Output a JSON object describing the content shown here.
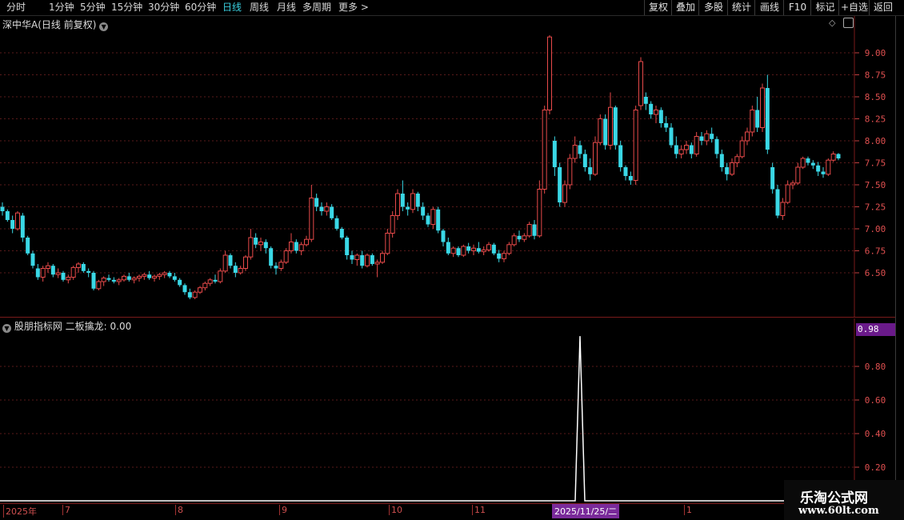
{
  "toolbar": {
    "periods": [
      "分时",
      "1分钟",
      "5分钟",
      "15分钟",
      "30分钟",
      "60分钟",
      "日线",
      "周线",
      "月线",
      "多周期",
      "更多"
    ],
    "active_period": "日线",
    "more_arrow": ">",
    "right_buttons": [
      "复权",
      "叠加",
      "多股",
      "统计",
      "画线",
      "F10",
      "标记",
      "+自选",
      "返回"
    ]
  },
  "main_pane": {
    "title": "深中华A(日线 前复权)",
    "price_ticks": [
      "9.00",
      "8.75",
      "8.50",
      "8.25",
      "8.00",
      "7.75",
      "7.50",
      "7.25",
      "7.00",
      "6.75",
      "6.50"
    ]
  },
  "sub_pane": {
    "title": "股朋指标网 二板擒龙: 0.00",
    "current_value": "0.98",
    "ticks": [
      "0.80",
      "0.60",
      "0.40",
      "0.20"
    ]
  },
  "date_axis": {
    "labels": [
      "2025年",
      "7",
      "8",
      "9",
      "10",
      "11",
      "1"
    ],
    "cursor_date": "2025/11/25/二"
  },
  "watermark": {
    "line1": "乐淘公式网",
    "line2": "www.60lt.com"
  },
  "colors": {
    "up": "#e84a4a",
    "down": "#3ad8e6",
    "grid": "#5a1a1a",
    "accent": "#3ad0e0",
    "cursor_bg": "#7a2a9a"
  },
  "candles": [
    [
      7.25,
      7.3,
      7.15,
      7.2
    ],
    [
      7.2,
      7.22,
      7.08,
      7.1
    ],
    [
      7.1,
      7.15,
      6.95,
      7.0
    ],
    [
      7.0,
      7.2,
      6.98,
      7.18
    ],
    [
      7.15,
      7.18,
      6.85,
      6.9
    ],
    [
      6.9,
      6.92,
      6.7,
      6.72
    ],
    [
      6.72,
      6.75,
      6.55,
      6.58
    ],
    [
      6.55,
      6.6,
      6.42,
      6.45
    ],
    [
      6.45,
      6.58,
      6.4,
      6.55
    ],
    [
      6.55,
      6.62,
      6.5,
      6.58
    ],
    [
      6.58,
      6.6,
      6.45,
      6.48
    ],
    [
      6.48,
      6.55,
      6.44,
      6.5
    ],
    [
      6.5,
      6.52,
      6.4,
      6.42
    ],
    [
      6.42,
      6.48,
      6.38,
      6.45
    ],
    [
      6.45,
      6.58,
      6.42,
      6.56
    ],
    [
      6.56,
      6.62,
      6.5,
      6.6
    ],
    [
      6.6,
      6.62,
      6.5,
      6.52
    ],
    [
      6.52,
      6.55,
      6.45,
      6.5
    ],
    [
      6.5,
      6.52,
      6.3,
      6.32
    ],
    [
      6.32,
      6.42,
      6.3,
      6.4
    ],
    [
      6.4,
      6.46,
      6.35,
      6.44
    ],
    [
      6.44,
      6.48,
      6.4,
      6.42
    ],
    [
      6.42,
      6.45,
      6.38,
      6.4
    ],
    [
      6.4,
      6.44,
      6.36,
      6.42
    ],
    [
      6.42,
      6.48,
      6.4,
      6.46
    ],
    [
      6.46,
      6.5,
      6.4,
      6.42
    ],
    [
      6.42,
      6.46,
      6.38,
      6.44
    ],
    [
      6.44,
      6.48,
      6.4,
      6.46
    ],
    [
      6.46,
      6.5,
      6.42,
      6.48
    ],
    [
      6.48,
      6.52,
      6.42,
      6.44
    ],
    [
      6.44,
      6.48,
      6.4,
      6.46
    ],
    [
      6.46,
      6.5,
      6.42,
      6.48
    ],
    [
      6.48,
      6.52,
      6.44,
      6.5
    ],
    [
      6.5,
      6.52,
      6.44,
      6.46
    ],
    [
      6.46,
      6.5,
      6.4,
      6.42
    ],
    [
      6.42,
      6.44,
      6.34,
      6.36
    ],
    [
      6.36,
      6.38,
      6.25,
      6.28
    ],
    [
      6.28,
      6.32,
      6.2,
      6.22
    ],
    [
      6.22,
      6.3,
      6.2,
      6.28
    ],
    [
      6.28,
      6.35,
      6.26,
      6.33
    ],
    [
      6.33,
      6.4,
      6.3,
      6.38
    ],
    [
      6.38,
      6.44,
      6.35,
      6.42
    ],
    [
      6.42,
      6.48,
      6.38,
      6.4
    ],
    [
      6.4,
      6.55,
      6.38,
      6.52
    ],
    [
      6.52,
      6.75,
      6.5,
      6.7
    ],
    [
      6.7,
      6.72,
      6.55,
      6.58
    ],
    [
      6.58,
      6.62,
      6.45,
      6.5
    ],
    [
      6.5,
      6.58,
      6.48,
      6.55
    ],
    [
      6.55,
      6.7,
      6.52,
      6.68
    ],
    [
      6.68,
      7.0,
      6.65,
      6.9
    ],
    [
      6.9,
      6.95,
      6.78,
      6.82
    ],
    [
      6.82,
      6.9,
      6.75,
      6.85
    ],
    [
      6.85,
      6.88,
      6.72,
      6.78
    ],
    [
      6.78,
      6.8,
      6.55,
      6.58
    ],
    [
      6.58,
      6.62,
      6.48,
      6.55
    ],
    [
      6.55,
      6.65,
      6.52,
      6.62
    ],
    [
      6.62,
      6.78,
      6.6,
      6.75
    ],
    [
      6.75,
      6.95,
      6.72,
      6.85
    ],
    [
      6.85,
      6.88,
      6.72,
      6.75
    ],
    [
      6.75,
      6.85,
      6.7,
      6.82
    ],
    [
      6.82,
      6.92,
      6.8,
      6.88
    ],
    [
      6.88,
      7.5,
      6.85,
      7.35
    ],
    [
      7.35,
      7.4,
      7.2,
      7.25
    ],
    [
      7.25,
      7.3,
      7.15,
      7.2
    ],
    [
      7.2,
      7.3,
      7.15,
      7.25
    ],
    [
      7.25,
      7.28,
      7.1,
      7.12
    ],
    [
      7.12,
      7.15,
      6.98,
      7.0
    ],
    [
      7.0,
      7.02,
      6.88,
      6.9
    ],
    [
      6.9,
      6.92,
      6.65,
      6.7
    ],
    [
      6.7,
      6.75,
      6.6,
      6.65
    ],
    [
      6.65,
      6.72,
      6.58,
      6.7
    ],
    [
      6.7,
      6.75,
      6.55,
      6.58
    ],
    [
      6.58,
      6.72,
      6.56,
      6.7
    ],
    [
      6.7,
      6.72,
      6.58,
      6.6
    ],
    [
      6.6,
      6.65,
      6.45,
      6.62
    ],
    [
      6.62,
      6.75,
      6.6,
      6.72
    ],
    [
      6.72,
      7.0,
      6.7,
      6.95
    ],
    [
      6.95,
      7.2,
      6.9,
      7.15
    ],
    [
      7.15,
      7.45,
      7.1,
      7.4
    ],
    [
      7.4,
      7.55,
      7.2,
      7.25
    ],
    [
      7.25,
      7.3,
      7.15,
      7.22
    ],
    [
      7.22,
      7.45,
      7.18,
      7.4
    ],
    [
      7.4,
      7.42,
      7.2,
      7.25
    ],
    [
      7.25,
      7.3,
      7.1,
      7.15
    ],
    [
      7.15,
      7.18,
      7.02,
      7.05
    ],
    [
      7.05,
      7.25,
      7.0,
      7.22
    ],
    [
      7.22,
      7.25,
      6.95,
      6.98
    ],
    [
      6.98,
      7.0,
      6.8,
      6.85
    ],
    [
      6.85,
      6.9,
      6.7,
      6.72
    ],
    [
      6.72,
      6.8,
      6.68,
      6.78
    ],
    [
      6.78,
      6.8,
      6.68,
      6.7
    ],
    [
      6.7,
      6.82,
      6.68,
      6.8
    ],
    [
      6.8,
      6.84,
      6.72,
      6.75
    ],
    [
      6.75,
      6.82,
      6.7,
      6.78
    ],
    [
      6.78,
      6.85,
      6.72,
      6.74
    ],
    [
      6.74,
      6.8,
      6.7,
      6.76
    ],
    [
      6.76,
      6.85,
      6.74,
      6.82
    ],
    [
      6.82,
      6.84,
      6.7,
      6.72
    ],
    [
      6.72,
      6.76,
      6.62,
      6.66
    ],
    [
      6.66,
      6.75,
      6.62,
      6.72
    ],
    [
      6.72,
      6.85,
      6.7,
      6.82
    ],
    [
      6.82,
      6.95,
      6.8,
      6.92
    ],
    [
      6.92,
      6.98,
      6.85,
      6.88
    ],
    [
      6.88,
      6.95,
      6.85,
      6.92
    ],
    [
      6.92,
      7.08,
      6.9,
      7.05
    ],
    [
      7.05,
      7.1,
      6.88,
      6.92
    ],
    [
      6.92,
      7.55,
      6.9,
      7.45
    ],
    [
      7.45,
      8.4,
      7.4,
      8.35
    ],
    [
      8.35,
      9.2,
      8.3,
      9.18
    ],
    [
      8.0,
      8.05,
      7.6,
      7.7
    ],
    [
      7.7,
      7.75,
      7.25,
      7.3
    ],
    [
      7.3,
      7.55,
      7.25,
      7.5
    ],
    [
      7.5,
      7.85,
      7.45,
      7.8
    ],
    [
      7.8,
      8.05,
      7.75,
      7.95
    ],
    [
      7.95,
      8.0,
      7.8,
      7.85
    ],
    [
      7.85,
      7.9,
      7.65,
      7.7
    ],
    [
      7.7,
      7.8,
      7.55,
      7.62
    ],
    [
      7.62,
      8.05,
      7.6,
      7.98
    ],
    [
      7.98,
      8.3,
      7.95,
      8.25
    ],
    [
      8.25,
      8.3,
      7.9,
      7.95
    ],
    [
      7.95,
      8.55,
      7.9,
      8.38
    ],
    [
      8.38,
      8.4,
      7.9,
      7.95
    ],
    [
      7.95,
      8.0,
      7.65,
      7.7
    ],
    [
      7.7,
      7.72,
      7.55,
      7.6
    ],
    [
      7.6,
      7.65,
      7.5,
      7.55
    ],
    [
      7.55,
      8.4,
      7.5,
      8.35
    ],
    [
      8.4,
      8.95,
      8.35,
      8.9
    ],
    [
      8.5,
      8.55,
      8.35,
      8.42
    ],
    [
      8.42,
      8.45,
      8.25,
      8.3
    ],
    [
      8.3,
      8.4,
      8.2,
      8.35
    ],
    [
      8.35,
      8.38,
      8.15,
      8.2
    ],
    [
      8.2,
      8.28,
      8.1,
      8.15
    ],
    [
      8.15,
      8.2,
      7.92,
      7.95
    ],
    [
      7.95,
      8.05,
      7.8,
      7.85
    ],
    [
      7.85,
      7.95,
      7.8,
      7.9
    ],
    [
      7.9,
      8.0,
      7.85,
      7.95
    ],
    [
      7.95,
      7.98,
      7.8,
      7.85
    ],
    [
      7.85,
      8.1,
      7.82,
      8.05
    ],
    [
      8.05,
      8.1,
      7.95,
      8.0
    ],
    [
      8.0,
      8.12,
      7.95,
      8.08
    ],
    [
      8.08,
      8.15,
      7.98,
      8.02
    ],
    [
      8.02,
      8.05,
      7.8,
      7.85
    ],
    [
      7.85,
      7.9,
      7.65,
      7.7
    ],
    [
      7.7,
      7.75,
      7.55,
      7.62
    ],
    [
      7.62,
      7.8,
      7.6,
      7.75
    ],
    [
      7.75,
      7.85,
      7.7,
      7.82
    ],
    [
      7.82,
      8.05,
      7.8,
      8.0
    ],
    [
      8.0,
      8.15,
      7.95,
      8.1
    ],
    [
      8.1,
      8.4,
      8.05,
      8.35
    ],
    [
      8.35,
      8.5,
      8.1,
      8.15
    ],
    [
      8.15,
      8.65,
      8.1,
      8.6
    ],
    [
      8.6,
      8.75,
      7.85,
      7.9
    ],
    [
      7.7,
      7.75,
      7.4,
      7.45
    ],
    [
      7.45,
      7.5,
      7.12,
      7.15
    ],
    [
      7.15,
      7.35,
      7.1,
      7.3
    ],
    [
      7.3,
      7.55,
      7.28,
      7.5
    ],
    [
      7.5,
      7.55,
      7.45,
      7.52
    ],
    [
      7.52,
      7.75,
      7.5,
      7.7
    ],
    [
      7.7,
      7.82,
      7.68,
      7.8
    ],
    [
      7.8,
      7.82,
      7.72,
      7.75
    ],
    [
      7.75,
      7.78,
      7.68,
      7.72
    ],
    [
      7.72,
      7.76,
      7.6,
      7.65
    ],
    [
      7.65,
      7.7,
      7.58,
      7.62
    ],
    [
      7.62,
      7.8,
      7.6,
      7.78
    ],
    [
      7.78,
      7.88,
      7.76,
      7.85
    ],
    [
      7.85,
      7.86,
      7.78,
      7.8
    ]
  ],
  "signal": {
    "spike_index": 114,
    "spike_value": 0.98
  }
}
